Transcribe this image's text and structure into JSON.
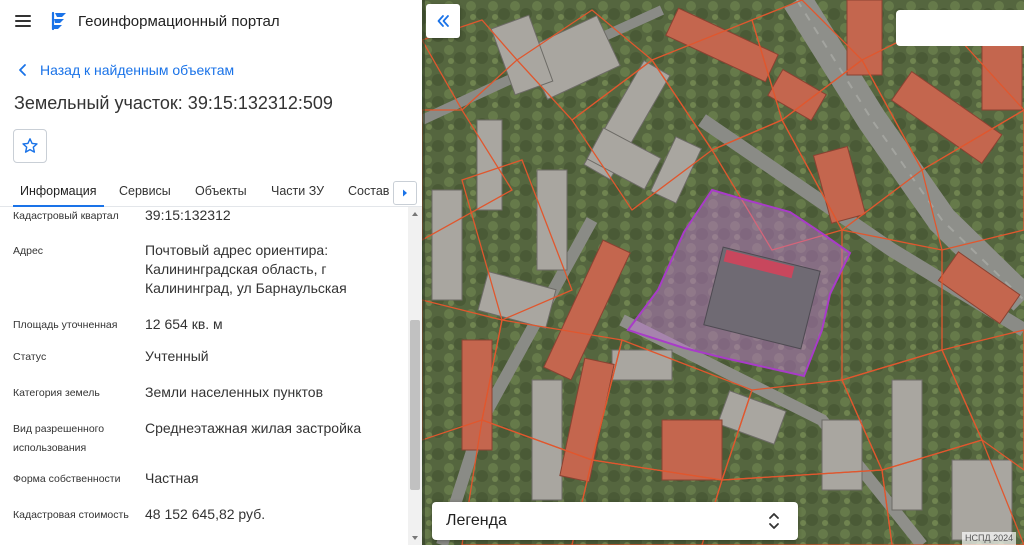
{
  "app": {
    "title": "Геоинформационный портал"
  },
  "nav": {
    "back_label": "Назад к найденным объектам"
  },
  "object": {
    "title": "Земельный участок: 39:15:132312:509"
  },
  "tabs": [
    {
      "label": "Информация",
      "active": true
    },
    {
      "label": "Сервисы",
      "active": false
    },
    {
      "label": "Объекты",
      "active": false
    },
    {
      "label": "Части ЗУ",
      "active": false
    },
    {
      "label": "Состав",
      "active": false
    }
  ],
  "info": [
    {
      "label": "Кадастровый квартал",
      "value": "39:15:132312"
    },
    {
      "label": "Адрес",
      "value": "Почтовый адрес ориентира: Калининградская область, г Калининград, ул Барнаульская"
    },
    {
      "label": "Площадь уточненная",
      "value": "12 654 кв. м"
    },
    {
      "label": "Статус",
      "value": "Учтенный"
    },
    {
      "label": "Категория земель",
      "value": "Земли населенных пунктов"
    },
    {
      "label": "Вид разрешенного использования",
      "value": "Среднеэтажная жилая застройка"
    },
    {
      "label": "Форма собственности",
      "value": "Частная"
    },
    {
      "label": "Кадастровая стоимость",
      "value": "48 152 645,82 руб."
    }
  ],
  "map": {
    "search_value": "",
    "legend_label": "Легенда",
    "attribution": "НСПД 2024",
    "parcel_color": "#a83cc8",
    "boundary_color": "#e0572e"
  },
  "colors": {
    "accent": "#1a73e8"
  },
  "icons": {
    "menu": "hamburger-icon",
    "logo": "portal-logo-icon",
    "back": "chevron-left-icon",
    "favorite": "star-icon",
    "tabs_next": "chevron-right-icon",
    "collapse": "double-chevron-left-icon",
    "legend": "up-down-chevron-icon"
  }
}
